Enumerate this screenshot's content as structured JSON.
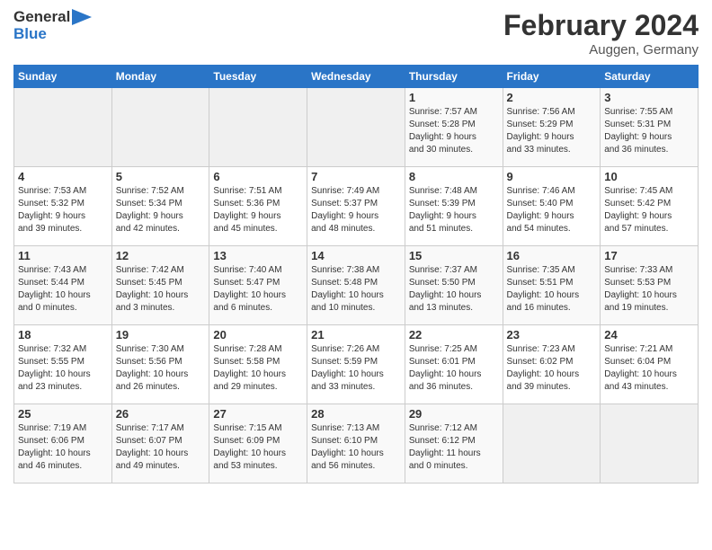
{
  "header": {
    "logo_general": "General",
    "logo_blue": "Blue",
    "month_title": "February 2024",
    "subtitle": "Auggen, Germany"
  },
  "days_of_week": [
    "Sunday",
    "Monday",
    "Tuesday",
    "Wednesday",
    "Thursday",
    "Friday",
    "Saturday"
  ],
  "weeks": [
    [
      {
        "day": "",
        "info": ""
      },
      {
        "day": "",
        "info": ""
      },
      {
        "day": "",
        "info": ""
      },
      {
        "day": "",
        "info": ""
      },
      {
        "day": "1",
        "info": "Sunrise: 7:57 AM\nSunset: 5:28 PM\nDaylight: 9 hours\nand 30 minutes."
      },
      {
        "day": "2",
        "info": "Sunrise: 7:56 AM\nSunset: 5:29 PM\nDaylight: 9 hours\nand 33 minutes."
      },
      {
        "day": "3",
        "info": "Sunrise: 7:55 AM\nSunset: 5:31 PM\nDaylight: 9 hours\nand 36 minutes."
      }
    ],
    [
      {
        "day": "4",
        "info": "Sunrise: 7:53 AM\nSunset: 5:32 PM\nDaylight: 9 hours\nand 39 minutes."
      },
      {
        "day": "5",
        "info": "Sunrise: 7:52 AM\nSunset: 5:34 PM\nDaylight: 9 hours\nand 42 minutes."
      },
      {
        "day": "6",
        "info": "Sunrise: 7:51 AM\nSunset: 5:36 PM\nDaylight: 9 hours\nand 45 minutes."
      },
      {
        "day": "7",
        "info": "Sunrise: 7:49 AM\nSunset: 5:37 PM\nDaylight: 9 hours\nand 48 minutes."
      },
      {
        "day": "8",
        "info": "Sunrise: 7:48 AM\nSunset: 5:39 PM\nDaylight: 9 hours\nand 51 minutes."
      },
      {
        "day": "9",
        "info": "Sunrise: 7:46 AM\nSunset: 5:40 PM\nDaylight: 9 hours\nand 54 minutes."
      },
      {
        "day": "10",
        "info": "Sunrise: 7:45 AM\nSunset: 5:42 PM\nDaylight: 9 hours\nand 57 minutes."
      }
    ],
    [
      {
        "day": "11",
        "info": "Sunrise: 7:43 AM\nSunset: 5:44 PM\nDaylight: 10 hours\nand 0 minutes."
      },
      {
        "day": "12",
        "info": "Sunrise: 7:42 AM\nSunset: 5:45 PM\nDaylight: 10 hours\nand 3 minutes."
      },
      {
        "day": "13",
        "info": "Sunrise: 7:40 AM\nSunset: 5:47 PM\nDaylight: 10 hours\nand 6 minutes."
      },
      {
        "day": "14",
        "info": "Sunrise: 7:38 AM\nSunset: 5:48 PM\nDaylight: 10 hours\nand 10 minutes."
      },
      {
        "day": "15",
        "info": "Sunrise: 7:37 AM\nSunset: 5:50 PM\nDaylight: 10 hours\nand 13 minutes."
      },
      {
        "day": "16",
        "info": "Sunrise: 7:35 AM\nSunset: 5:51 PM\nDaylight: 10 hours\nand 16 minutes."
      },
      {
        "day": "17",
        "info": "Sunrise: 7:33 AM\nSunset: 5:53 PM\nDaylight: 10 hours\nand 19 minutes."
      }
    ],
    [
      {
        "day": "18",
        "info": "Sunrise: 7:32 AM\nSunset: 5:55 PM\nDaylight: 10 hours\nand 23 minutes."
      },
      {
        "day": "19",
        "info": "Sunrise: 7:30 AM\nSunset: 5:56 PM\nDaylight: 10 hours\nand 26 minutes."
      },
      {
        "day": "20",
        "info": "Sunrise: 7:28 AM\nSunset: 5:58 PM\nDaylight: 10 hours\nand 29 minutes."
      },
      {
        "day": "21",
        "info": "Sunrise: 7:26 AM\nSunset: 5:59 PM\nDaylight: 10 hours\nand 33 minutes."
      },
      {
        "day": "22",
        "info": "Sunrise: 7:25 AM\nSunset: 6:01 PM\nDaylight: 10 hours\nand 36 minutes."
      },
      {
        "day": "23",
        "info": "Sunrise: 7:23 AM\nSunset: 6:02 PM\nDaylight: 10 hours\nand 39 minutes."
      },
      {
        "day": "24",
        "info": "Sunrise: 7:21 AM\nSunset: 6:04 PM\nDaylight: 10 hours\nand 43 minutes."
      }
    ],
    [
      {
        "day": "25",
        "info": "Sunrise: 7:19 AM\nSunset: 6:06 PM\nDaylight: 10 hours\nand 46 minutes."
      },
      {
        "day": "26",
        "info": "Sunrise: 7:17 AM\nSunset: 6:07 PM\nDaylight: 10 hours\nand 49 minutes."
      },
      {
        "day": "27",
        "info": "Sunrise: 7:15 AM\nSunset: 6:09 PM\nDaylight: 10 hours\nand 53 minutes."
      },
      {
        "day": "28",
        "info": "Sunrise: 7:13 AM\nSunset: 6:10 PM\nDaylight: 10 hours\nand 56 minutes."
      },
      {
        "day": "29",
        "info": "Sunrise: 7:12 AM\nSunset: 6:12 PM\nDaylight: 11 hours\nand 0 minutes."
      },
      {
        "day": "",
        "info": ""
      },
      {
        "day": "",
        "info": ""
      }
    ]
  ]
}
